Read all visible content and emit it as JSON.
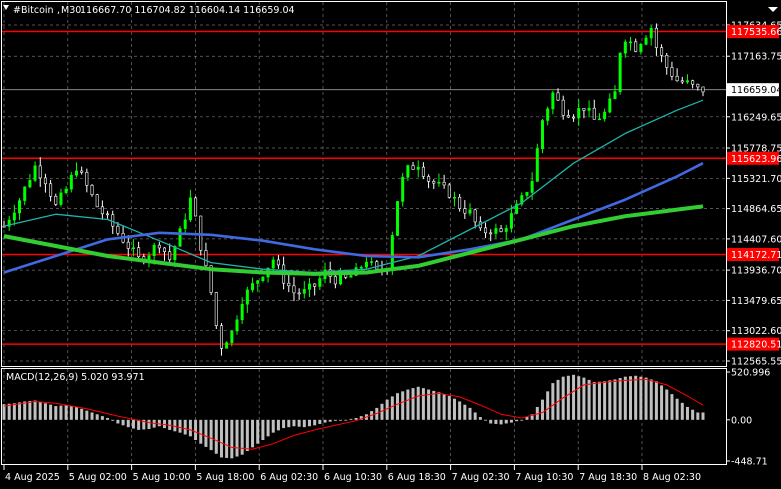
{
  "header": {
    "symbol": "#Bitcoin",
    "timeframe": "M30",
    "ohlc": "116667.70 116704.82 116604.14 116659.04"
  },
  "colors": {
    "background": "#000000",
    "grid": "#d0d0d0",
    "bull": "#00ff00",
    "bear": "#ffffff",
    "level": "#ff0000",
    "ma_fast": "#20b2aa",
    "ma_mid": "#4169e1",
    "ma_slow": "#32cd32",
    "macd_hist": "#c0c0c0",
    "macd_signal": "#ff0000"
  },
  "chart_data": [
    {
      "type": "candlestick",
      "title": "#Bitcoin,M30",
      "ylim": [
        112565.55,
        117634.65
      ],
      "y_ticks": [
        117634.65,
        117163.75,
        116249.65,
        115778.75,
        115321.7,
        114864.65,
        114407.6,
        113936.7,
        113479.65,
        113022.6,
        112565.55
      ],
      "x_ticks": [
        "4 Aug 2025",
        "5 Aug 02:00",
        "5 Aug 10:00",
        "5 Aug 18:00",
        "6 Aug 02:30",
        "6 Aug 10:30",
        "6 Aug 18:30",
        "7 Aug 02:30",
        "7 Aug 10:30",
        "7 Aug 18:30",
        "8 Aug 02:30"
      ],
      "close_path": [
        [
          0,
          114600
        ],
        [
          3,
          115000
        ],
        [
          6,
          115500
        ],
        [
          8,
          115300
        ],
        [
          10,
          114900
        ],
        [
          12,
          115150
        ],
        [
          14,
          115500
        ],
        [
          16,
          115200
        ],
        [
          18,
          114900
        ],
        [
          20,
          114700
        ],
        [
          22,
          114500
        ],
        [
          24,
          114300
        ],
        [
          26,
          114100
        ],
        [
          28,
          114200
        ],
        [
          30,
          114350
        ],
        [
          32,
          114100
        ],
        [
          34,
          114500
        ],
        [
          36,
          115000
        ],
        [
          37,
          114700
        ],
        [
          38,
          114300
        ],
        [
          40,
          113600
        ],
        [
          41,
          113100
        ],
        [
          42,
          112800
        ],
        [
          44,
          113000
        ],
        [
          46,
          113500
        ],
        [
          48,
          113700
        ],
        [
          50,
          113900
        ],
        [
          52,
          114100
        ],
        [
          54,
          113800
        ],
        [
          56,
          113600
        ],
        [
          58,
          113600
        ],
        [
          60,
          113700
        ],
        [
          62,
          113900
        ],
        [
          64,
          113800
        ],
        [
          66,
          113800
        ],
        [
          68,
          113900
        ],
        [
          70,
          114100
        ],
        [
          72,
          113900
        ],
        [
          74,
          114000
        ],
        [
          75,
          114500
        ],
        [
          76,
          115000
        ],
        [
          77,
          115300
        ],
        [
          78,
          115450
        ],
        [
          80,
          115550
        ],
        [
          82,
          115300
        ],
        [
          84,
          115200
        ],
        [
          86,
          115100
        ],
        [
          88,
          114900
        ],
        [
          90,
          114800
        ],
        [
          92,
          114500
        ],
        [
          94,
          114550
        ],
        [
          96,
          114500
        ],
        [
          98,
          114750
        ],
        [
          100,
          115000
        ],
        [
          102,
          115300
        ],
        [
          104,
          116200
        ],
        [
          106,
          116600
        ],
        [
          108,
          116350
        ],
        [
          110,
          116300
        ],
        [
          112,
          116400
        ],
        [
          114,
          116200
        ],
        [
          116,
          116300
        ],
        [
          118,
          116600
        ],
        [
          119,
          117250
        ],
        [
          120,
          117450
        ],
        [
          122,
          117300
        ],
        [
          124,
          117500
        ],
        [
          125,
          117600
        ],
        [
          126,
          117300
        ],
        [
          128,
          117000
        ],
        [
          130,
          116800
        ],
        [
          132,
          116750
        ],
        [
          134,
          116659
        ]
      ],
      "levels": [
        {
          "value": 117535.66,
          "label": "117535.66"
        },
        {
          "value": 115623.96,
          "label": "115623.96"
        },
        {
          "value": 114172.71,
          "label": "114172.71"
        },
        {
          "value": 112820.51,
          "label": "112820.51"
        }
      ],
      "current_price": {
        "value": 116659.04,
        "label": "116659.04"
      },
      "moving_averages": [
        {
          "key": "fast",
          "points": [
            [
              0,
              114600
            ],
            [
              10,
              114780
            ],
            [
              20,
              114700
            ],
            [
              30,
              114380
            ],
            [
              40,
              114050
            ],
            [
              50,
              113950
            ],
            [
              60,
              113900
            ],
            [
              70,
              113950
            ],
            [
              80,
              114150
            ],
            [
              90,
              114550
            ],
            [
              100,
              114950
            ],
            [
              110,
              115550
            ],
            [
              120,
              116000
            ],
            [
              130,
              116350
            ],
            [
              135,
              116500
            ]
          ]
        },
        {
          "key": "mid",
          "points": [
            [
              0,
              113900
            ],
            [
              10,
              114150
            ],
            [
              20,
              114400
            ],
            [
              30,
              114500
            ],
            [
              40,
              114470
            ],
            [
              50,
              114380
            ],
            [
              60,
              114250
            ],
            [
              70,
              114150
            ],
            [
              80,
              114130
            ],
            [
              90,
              114250
            ],
            [
              100,
              114400
            ],
            [
              110,
              114700
            ],
            [
              120,
              115000
            ],
            [
              130,
              115350
            ],
            [
              135,
              115550
            ]
          ]
        },
        {
          "key": "slow",
          "points": [
            [
              0,
              114450
            ],
            [
              10,
              114300
            ],
            [
              20,
              114150
            ],
            [
              30,
              114050
            ],
            [
              40,
              113950
            ],
            [
              50,
              113900
            ],
            [
              60,
              113880
            ],
            [
              70,
              113900
            ],
            [
              80,
              114000
            ],
            [
              90,
              114200
            ],
            [
              100,
              114400
            ],
            [
              110,
              114600
            ],
            [
              120,
              114750
            ],
            [
              130,
              114850
            ],
            [
              135,
              114900
            ]
          ]
        }
      ]
    },
    {
      "type": "bar",
      "title": "MACD(12,26,9) 5.020 93.971",
      "ylim": [
        -448.71,
        520.996
      ],
      "y_ticks": [
        520.996,
        0.0,
        -448.71
      ],
      "histogram": [
        [
          0,
          170
        ],
        [
          2,
          180
        ],
        [
          4,
          200
        ],
        [
          6,
          210
        ],
        [
          8,
          180
        ],
        [
          10,
          150
        ],
        [
          12,
          160
        ],
        [
          14,
          140
        ],
        [
          16,
          100
        ],
        [
          18,
          60
        ],
        [
          20,
          20
        ],
        [
          22,
          -40
        ],
        [
          24,
          -80
        ],
        [
          26,
          -110
        ],
        [
          28,
          -100
        ],
        [
          30,
          -70
        ],
        [
          32,
          -110
        ],
        [
          34,
          -140
        ],
        [
          36,
          -180
        ],
        [
          38,
          -260
        ],
        [
          40,
          -330
        ],
        [
          42,
          -410
        ],
        [
          44,
          -420
        ],
        [
          46,
          -380
        ],
        [
          48,
          -300
        ],
        [
          50,
          -220
        ],
        [
          52,
          -140
        ],
        [
          54,
          -90
        ],
        [
          56,
          -70
        ],
        [
          58,
          -80
        ],
        [
          60,
          -60
        ],
        [
          62,
          -30
        ],
        [
          64,
          -10
        ],
        [
          66,
          0
        ],
        [
          68,
          20
        ],
        [
          70,
          60
        ],
        [
          72,
          130
        ],
        [
          74,
          220
        ],
        [
          76,
          290
        ],
        [
          78,
          330
        ],
        [
          80,
          360
        ],
        [
          82,
          330
        ],
        [
          84,
          300
        ],
        [
          86,
          260
        ],
        [
          88,
          200
        ],
        [
          90,
          130
        ],
        [
          92,
          30
        ],
        [
          94,
          -40
        ],
        [
          96,
          -50
        ],
        [
          98,
          -30
        ],
        [
          100,
          0
        ],
        [
          102,
          60
        ],
        [
          104,
          220
        ],
        [
          106,
          400
        ],
        [
          108,
          470
        ],
        [
          110,
          490
        ],
        [
          112,
          460
        ],
        [
          114,
          410
        ],
        [
          116,
          420
        ],
        [
          118,
          440
        ],
        [
          120,
          470
        ],
        [
          122,
          480
        ],
        [
          124,
          460
        ],
        [
          126,
          420
        ],
        [
          128,
          330
        ],
        [
          130,
          230
        ],
        [
          132,
          140
        ],
        [
          134,
          80
        ]
      ],
      "signal": [
        [
          0,
          150
        ],
        [
          6,
          200
        ],
        [
          10,
          180
        ],
        [
          16,
          120
        ],
        [
          22,
          40
        ],
        [
          28,
          -30
        ],
        [
          32,
          -60
        ],
        [
          36,
          -110
        ],
        [
          40,
          -200
        ],
        [
          44,
          -300
        ],
        [
          48,
          -320
        ],
        [
          52,
          -260
        ],
        [
          56,
          -170
        ],
        [
          60,
          -110
        ],
        [
          64,
          -60
        ],
        [
          68,
          -10
        ],
        [
          72,
          70
        ],
        [
          76,
          170
        ],
        [
          80,
          260
        ],
        [
          84,
          290
        ],
        [
          88,
          250
        ],
        [
          92,
          160
        ],
        [
          96,
          60
        ],
        [
          100,
          20
        ],
        [
          104,
          80
        ],
        [
          108,
          240
        ],
        [
          112,
          380
        ],
        [
          116,
          410
        ],
        [
          120,
          430
        ],
        [
          124,
          440
        ],
        [
          128,
          380
        ],
        [
          132,
          260
        ],
        [
          135,
          160
        ]
      ]
    }
  ]
}
